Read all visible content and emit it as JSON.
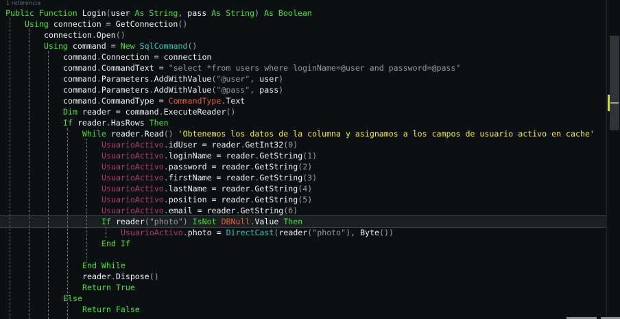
{
  "codelens": "1 referencia",
  "lines": [
    {
      "indent": 0,
      "tokens": [
        [
          "kw",
          "Public Function "
        ],
        [
          "txt",
          "Login"
        ],
        [
          "punc",
          "("
        ],
        [
          "txt",
          "user "
        ],
        [
          "kw",
          "As String"
        ],
        [
          "punc",
          ", "
        ],
        [
          "txt",
          "pass "
        ],
        [
          "kw",
          "As String"
        ],
        [
          "punc",
          ") "
        ],
        [
          "kw",
          "As Boolean"
        ]
      ]
    },
    {
      "indent": 1,
      "tokens": [
        [
          "kw",
          "Using "
        ],
        [
          "txt",
          "connection = GetConnection"
        ],
        [
          "punc",
          "()"
        ]
      ]
    },
    {
      "indent": 2,
      "tokens": [
        [
          "txt",
          "connection"
        ],
        [
          "punc",
          "."
        ],
        [
          "txt",
          "Open"
        ],
        [
          "punc",
          "()"
        ]
      ]
    },
    {
      "indent": 2,
      "tokens": [
        [
          "kw",
          "Using "
        ],
        [
          "txt",
          "command = "
        ],
        [
          "kw",
          "New "
        ],
        [
          "typ",
          "SqlCommand"
        ],
        [
          "punc",
          "()"
        ]
      ]
    },
    {
      "indent": 3,
      "tokens": [
        [
          "txt",
          "command"
        ],
        [
          "punc",
          "."
        ],
        [
          "txt",
          "Connection = connection"
        ]
      ]
    },
    {
      "indent": 3,
      "tokens": [
        [
          "txt",
          "command"
        ],
        [
          "punc",
          "."
        ],
        [
          "txt",
          "CommandText = "
        ],
        [
          "str",
          "\"select *from users where loginName=@user and password=@pass\""
        ]
      ]
    },
    {
      "indent": 3,
      "tokens": [
        [
          "txt",
          "command"
        ],
        [
          "punc",
          "."
        ],
        [
          "txt",
          "Parameters"
        ],
        [
          "punc",
          "."
        ],
        [
          "txt",
          "AddWithValue"
        ],
        [
          "punc",
          "("
        ],
        [
          "str",
          "\"@user\""
        ],
        [
          "punc",
          ", "
        ],
        [
          "txt",
          "user"
        ],
        [
          "punc",
          ")"
        ]
      ]
    },
    {
      "indent": 3,
      "tokens": [
        [
          "txt",
          "command"
        ],
        [
          "punc",
          "."
        ],
        [
          "txt",
          "Parameters"
        ],
        [
          "punc",
          "."
        ],
        [
          "txt",
          "AddWithValue"
        ],
        [
          "punc",
          "("
        ],
        [
          "str",
          "\"@pass\""
        ],
        [
          "punc",
          ", "
        ],
        [
          "txt",
          "pass"
        ],
        [
          "punc",
          ")"
        ]
      ]
    },
    {
      "indent": 3,
      "tokens": [
        [
          "txt",
          "command"
        ],
        [
          "punc",
          "."
        ],
        [
          "txt",
          "CommandType = "
        ],
        [
          "cls",
          "CommandType"
        ],
        [
          "punc",
          "."
        ],
        [
          "txt",
          "Text"
        ]
      ]
    },
    {
      "indent": 3,
      "tokens": [
        [
          "kw",
          "Dim "
        ],
        [
          "txt",
          "reader = command"
        ],
        [
          "punc",
          "."
        ],
        [
          "txt",
          "ExecuteReader"
        ],
        [
          "punc",
          "()"
        ]
      ]
    },
    {
      "indent": 3,
      "tokens": [
        [
          "kw",
          "If "
        ],
        [
          "txt",
          "reader"
        ],
        [
          "punc",
          "."
        ],
        [
          "txt",
          "HasRows "
        ],
        [
          "kw",
          "Then"
        ]
      ]
    },
    {
      "indent": 4,
      "tokens": [
        [
          "kw",
          "While "
        ],
        [
          "txt",
          "reader"
        ],
        [
          "punc",
          "."
        ],
        [
          "txt",
          "Read"
        ],
        [
          "punc",
          "() "
        ],
        [
          "cmt",
          "'Obtenemos los datos de la columna y asignamos a los campos de usuario activo en cache'"
        ]
      ]
    },
    {
      "indent": 5,
      "tokens": [
        [
          "fld",
          "UsuarioActivo"
        ],
        [
          "punc",
          "."
        ],
        [
          "txt",
          "idUser = reader"
        ],
        [
          "punc",
          "."
        ],
        [
          "txt",
          "GetInt32"
        ],
        [
          "punc",
          "("
        ],
        [
          "num",
          "0"
        ],
        [
          "punc",
          ")"
        ]
      ]
    },
    {
      "indent": 5,
      "tokens": [
        [
          "fld",
          "UsuarioActivo"
        ],
        [
          "punc",
          "."
        ],
        [
          "txt",
          "loginName = reader"
        ],
        [
          "punc",
          "."
        ],
        [
          "txt",
          "GetString"
        ],
        [
          "punc",
          "("
        ],
        [
          "num",
          "1"
        ],
        [
          "punc",
          ")"
        ]
      ]
    },
    {
      "indent": 5,
      "tokens": [
        [
          "fld",
          "UsuarioActivo"
        ],
        [
          "punc",
          "."
        ],
        [
          "txt",
          "password = reader"
        ],
        [
          "punc",
          "."
        ],
        [
          "txt",
          "GetString"
        ],
        [
          "punc",
          "("
        ],
        [
          "num",
          "2"
        ],
        [
          "punc",
          ")"
        ]
      ]
    },
    {
      "indent": 5,
      "tokens": [
        [
          "fld",
          "UsuarioActivo"
        ],
        [
          "punc",
          "."
        ],
        [
          "txt",
          "firstName = reader"
        ],
        [
          "punc",
          "."
        ],
        [
          "txt",
          "GetString"
        ],
        [
          "punc",
          "("
        ],
        [
          "num",
          "3"
        ],
        [
          "punc",
          ")"
        ]
      ]
    },
    {
      "indent": 5,
      "tokens": [
        [
          "fld",
          "UsuarioActivo"
        ],
        [
          "punc",
          "."
        ],
        [
          "txt",
          "lastName = reader"
        ],
        [
          "punc",
          "."
        ],
        [
          "txt",
          "GetString"
        ],
        [
          "punc",
          "("
        ],
        [
          "num",
          "4"
        ],
        [
          "punc",
          ")"
        ]
      ]
    },
    {
      "indent": 5,
      "tokens": [
        [
          "fld",
          "UsuarioActivo"
        ],
        [
          "punc",
          "."
        ],
        [
          "txt",
          "position = reader"
        ],
        [
          "punc",
          "."
        ],
        [
          "txt",
          "GetString"
        ],
        [
          "punc",
          "("
        ],
        [
          "num",
          "5"
        ],
        [
          "punc",
          ")"
        ]
      ]
    },
    {
      "indent": 5,
      "tokens": [
        [
          "fld",
          "UsuarioActivo"
        ],
        [
          "punc",
          "."
        ],
        [
          "txt",
          "email = reader"
        ],
        [
          "punc",
          "."
        ],
        [
          "txt",
          "GetString"
        ],
        [
          "punc",
          "("
        ],
        [
          "num",
          "6"
        ],
        [
          "punc",
          ")"
        ]
      ]
    },
    {
      "indent": 5,
      "highlight": true,
      "tokens": [
        [
          "kw",
          "If "
        ],
        [
          "txt",
          "reader"
        ],
        [
          "punc",
          "("
        ],
        [
          "str",
          "\"photo\""
        ],
        [
          "punc",
          ") "
        ],
        [
          "kw",
          "IsNot "
        ],
        [
          "cls",
          "DBNull"
        ],
        [
          "punc",
          "."
        ],
        [
          "txt",
          "Value "
        ],
        [
          "kw",
          "Then"
        ]
      ]
    },
    {
      "indent": 6,
      "tokens": [
        [
          "fld",
          "UsuarioActivo"
        ],
        [
          "punc",
          "."
        ],
        [
          "txt",
          "photo = "
        ],
        [
          "typ",
          "DirectCast"
        ],
        [
          "punc",
          "("
        ],
        [
          "txt",
          "reader"
        ],
        [
          "punc",
          "("
        ],
        [
          "str",
          "\"photo\""
        ],
        [
          "punc",
          "), "
        ],
        [
          "txt",
          "Byte"
        ],
        [
          "punc",
          "())"
        ]
      ]
    },
    {
      "indent": 5,
      "tokens": [
        [
          "kw",
          "End If"
        ]
      ]
    },
    {
      "indent": 5,
      "tokens": []
    },
    {
      "indent": 4,
      "tokens": [
        [
          "kw",
          "End While"
        ]
      ]
    },
    {
      "indent": 4,
      "tokens": [
        [
          "txt",
          "reader"
        ],
        [
          "punc",
          "."
        ],
        [
          "txt",
          "Dispose"
        ],
        [
          "punc",
          "()"
        ]
      ]
    },
    {
      "indent": 4,
      "tokens": [
        [
          "kw",
          "Return True"
        ]
      ]
    },
    {
      "indent": 3,
      "tokens": [
        [
          "kw",
          "Else"
        ]
      ]
    },
    {
      "indent": 4,
      "tokens": [
        [
          "kw",
          "Return False"
        ]
      ]
    }
  ]
}
